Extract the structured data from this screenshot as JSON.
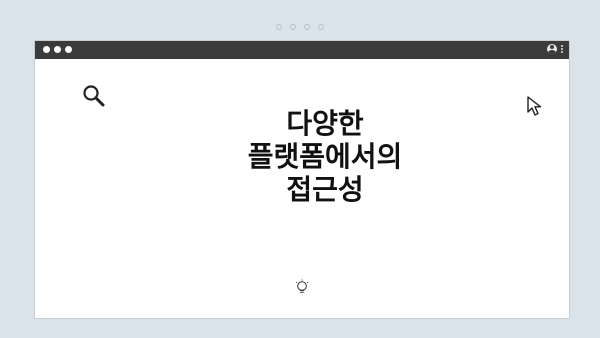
{
  "window": {
    "controls": [
      "close",
      "minimize",
      "maximize"
    ],
    "account_icon": "user-icon",
    "menu_icon": "kebab-icon"
  },
  "decor": {
    "left_icon": "search-icon",
    "right_icon": "cursor-icon",
    "bottom_icon": "lightbulb-icon"
  },
  "main": {
    "headline": "다양한\n플랫폼에서의\n접근성"
  },
  "colors": {
    "background": "#dbe3ea",
    "titlebar": "#3b3b3b",
    "window": "#ffffff",
    "text": "#111111"
  }
}
